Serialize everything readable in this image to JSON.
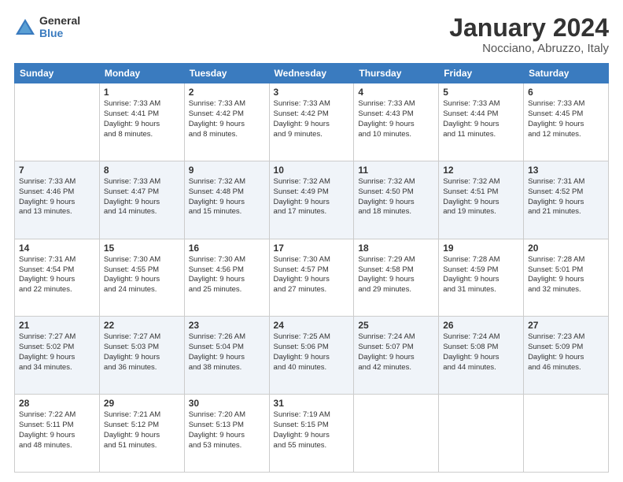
{
  "logo": {
    "line1": "General",
    "line2": "Blue"
  },
  "title": "January 2024",
  "location": "Nocciano, Abruzzo, Italy",
  "weekdays": [
    "Sunday",
    "Monday",
    "Tuesday",
    "Wednesday",
    "Thursday",
    "Friday",
    "Saturday"
  ],
  "weeks": [
    [
      {
        "day": null,
        "info": null
      },
      {
        "day": "1",
        "info": "Sunrise: 7:33 AM\nSunset: 4:41 PM\nDaylight: 9 hours\nand 8 minutes."
      },
      {
        "day": "2",
        "info": "Sunrise: 7:33 AM\nSunset: 4:42 PM\nDaylight: 9 hours\nand 8 minutes."
      },
      {
        "day": "3",
        "info": "Sunrise: 7:33 AM\nSunset: 4:42 PM\nDaylight: 9 hours\nand 9 minutes."
      },
      {
        "day": "4",
        "info": "Sunrise: 7:33 AM\nSunset: 4:43 PM\nDaylight: 9 hours\nand 10 minutes."
      },
      {
        "day": "5",
        "info": "Sunrise: 7:33 AM\nSunset: 4:44 PM\nDaylight: 9 hours\nand 11 minutes."
      },
      {
        "day": "6",
        "info": "Sunrise: 7:33 AM\nSunset: 4:45 PM\nDaylight: 9 hours\nand 12 minutes."
      }
    ],
    [
      {
        "day": "7",
        "info": "Sunrise: 7:33 AM\nSunset: 4:46 PM\nDaylight: 9 hours\nand 13 minutes."
      },
      {
        "day": "8",
        "info": "Sunrise: 7:33 AM\nSunset: 4:47 PM\nDaylight: 9 hours\nand 14 minutes."
      },
      {
        "day": "9",
        "info": "Sunrise: 7:32 AM\nSunset: 4:48 PM\nDaylight: 9 hours\nand 15 minutes."
      },
      {
        "day": "10",
        "info": "Sunrise: 7:32 AM\nSunset: 4:49 PM\nDaylight: 9 hours\nand 17 minutes."
      },
      {
        "day": "11",
        "info": "Sunrise: 7:32 AM\nSunset: 4:50 PM\nDaylight: 9 hours\nand 18 minutes."
      },
      {
        "day": "12",
        "info": "Sunrise: 7:32 AM\nSunset: 4:51 PM\nDaylight: 9 hours\nand 19 minutes."
      },
      {
        "day": "13",
        "info": "Sunrise: 7:31 AM\nSunset: 4:52 PM\nDaylight: 9 hours\nand 21 minutes."
      }
    ],
    [
      {
        "day": "14",
        "info": "Sunrise: 7:31 AM\nSunset: 4:54 PM\nDaylight: 9 hours\nand 22 minutes."
      },
      {
        "day": "15",
        "info": "Sunrise: 7:30 AM\nSunset: 4:55 PM\nDaylight: 9 hours\nand 24 minutes."
      },
      {
        "day": "16",
        "info": "Sunrise: 7:30 AM\nSunset: 4:56 PM\nDaylight: 9 hours\nand 25 minutes."
      },
      {
        "day": "17",
        "info": "Sunrise: 7:30 AM\nSunset: 4:57 PM\nDaylight: 9 hours\nand 27 minutes."
      },
      {
        "day": "18",
        "info": "Sunrise: 7:29 AM\nSunset: 4:58 PM\nDaylight: 9 hours\nand 29 minutes."
      },
      {
        "day": "19",
        "info": "Sunrise: 7:28 AM\nSunset: 4:59 PM\nDaylight: 9 hours\nand 31 minutes."
      },
      {
        "day": "20",
        "info": "Sunrise: 7:28 AM\nSunset: 5:01 PM\nDaylight: 9 hours\nand 32 minutes."
      }
    ],
    [
      {
        "day": "21",
        "info": "Sunrise: 7:27 AM\nSunset: 5:02 PM\nDaylight: 9 hours\nand 34 minutes."
      },
      {
        "day": "22",
        "info": "Sunrise: 7:27 AM\nSunset: 5:03 PM\nDaylight: 9 hours\nand 36 minutes."
      },
      {
        "day": "23",
        "info": "Sunrise: 7:26 AM\nSunset: 5:04 PM\nDaylight: 9 hours\nand 38 minutes."
      },
      {
        "day": "24",
        "info": "Sunrise: 7:25 AM\nSunset: 5:06 PM\nDaylight: 9 hours\nand 40 minutes."
      },
      {
        "day": "25",
        "info": "Sunrise: 7:24 AM\nSunset: 5:07 PM\nDaylight: 9 hours\nand 42 minutes."
      },
      {
        "day": "26",
        "info": "Sunrise: 7:24 AM\nSunset: 5:08 PM\nDaylight: 9 hours\nand 44 minutes."
      },
      {
        "day": "27",
        "info": "Sunrise: 7:23 AM\nSunset: 5:09 PM\nDaylight: 9 hours\nand 46 minutes."
      }
    ],
    [
      {
        "day": "28",
        "info": "Sunrise: 7:22 AM\nSunset: 5:11 PM\nDaylight: 9 hours\nand 48 minutes."
      },
      {
        "day": "29",
        "info": "Sunrise: 7:21 AM\nSunset: 5:12 PM\nDaylight: 9 hours\nand 51 minutes."
      },
      {
        "day": "30",
        "info": "Sunrise: 7:20 AM\nSunset: 5:13 PM\nDaylight: 9 hours\nand 53 minutes."
      },
      {
        "day": "31",
        "info": "Sunrise: 7:19 AM\nSunset: 5:15 PM\nDaylight: 9 hours\nand 55 minutes."
      },
      {
        "day": null,
        "info": null
      },
      {
        "day": null,
        "info": null
      },
      {
        "day": null,
        "info": null
      }
    ]
  ]
}
